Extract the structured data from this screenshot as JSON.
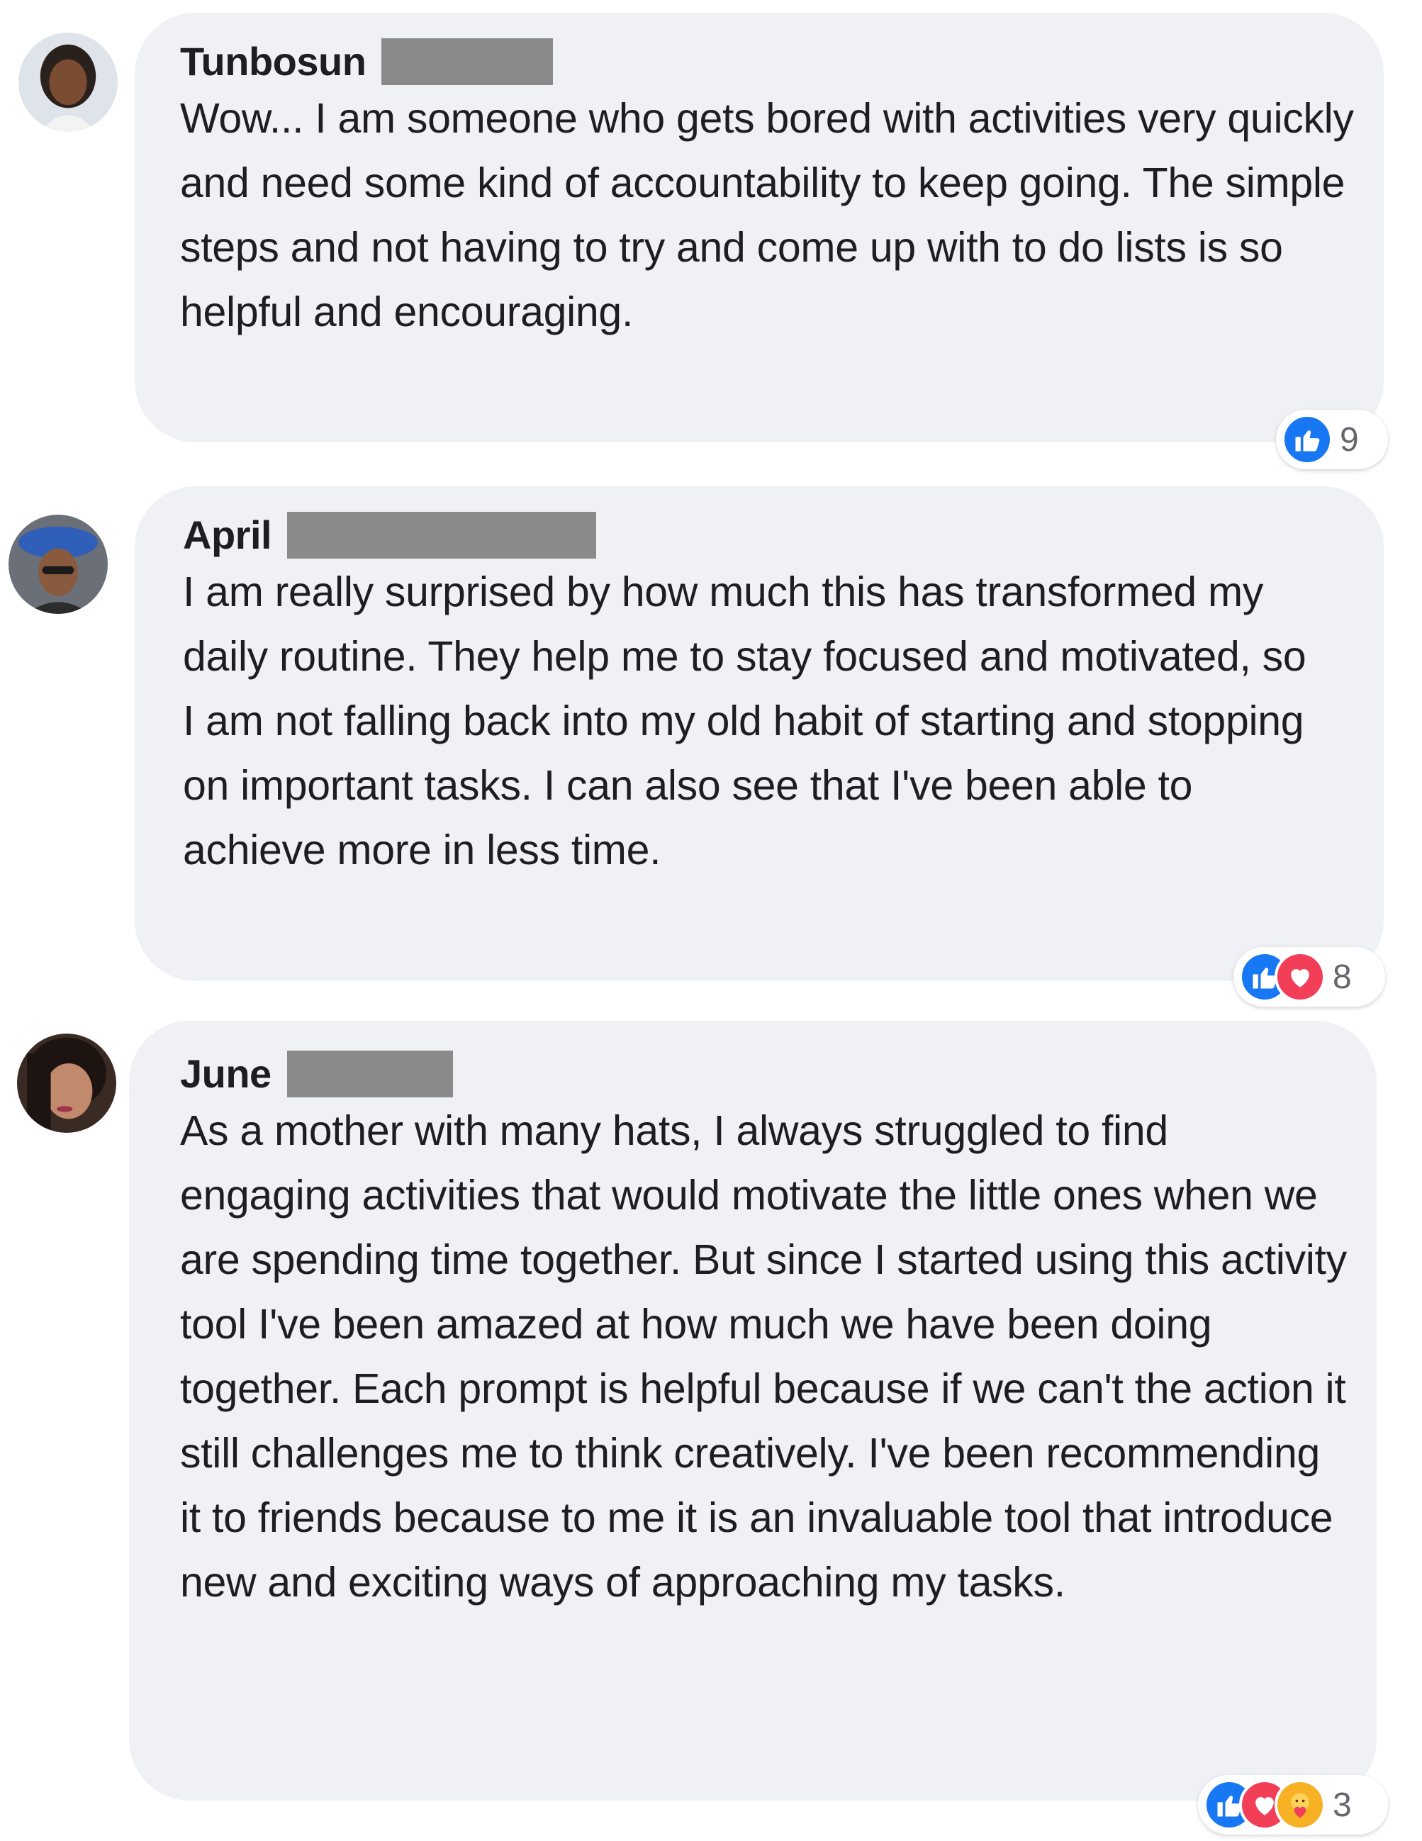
{
  "comments": [
    {
      "author": "Tunbosun",
      "text": "Wow... I am someone who gets bored with activities very quickly and need some kind of accountability to keep going. The simple steps and not having to try and come up with to do lists is so helpful and encouraging.",
      "reaction_count": "9",
      "reactions": [
        "like-icon"
      ]
    },
    {
      "author": "April",
      "text": "I am really surprised by how much this has transformed my daily routine. They help me to stay focused and motivated, so I am not falling back into my old habit of starting and stopping on important tasks. I can also see that I've been able to achieve more in less time.",
      "reaction_count": "8",
      "reactions": [
        "like-icon",
        "love-icon"
      ]
    },
    {
      "author": "June",
      "text": "As a mother with many hats, I always struggled to find engaging activities that would motivate the little ones when we are spending time together. But since I started using this activity tool I've been amazed at how much we have been doing together. Each prompt is helpful because if we can't the action it still challenges me to think creatively. I've been recommending it to friends because to me it is an invaluable tool that introduce new and exciting ways of approaching my tasks.",
      "reaction_count": "3",
      "reactions": [
        "like-icon",
        "love-icon",
        "care-icon"
      ]
    }
  ],
  "colors": {
    "bubble": "#eff1f5",
    "like": "#1877f2",
    "love": "#f33e58",
    "care": "#f7b125",
    "redaction": "#8a8a8a"
  }
}
